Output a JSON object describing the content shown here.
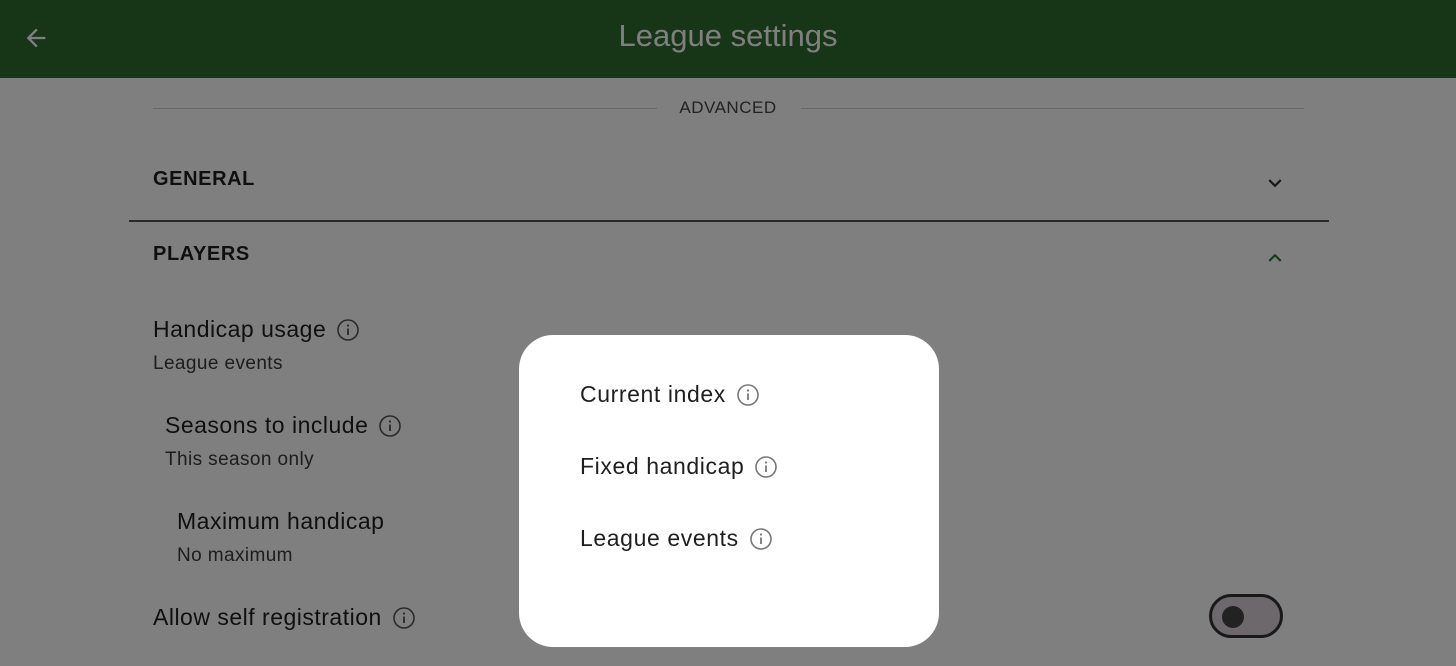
{
  "appbar": {
    "title": "League settings",
    "back_icon": "arrow-left-icon"
  },
  "divider": {
    "label": "ADVANCED"
  },
  "sections": {
    "general": {
      "label": "GENERAL",
      "state": "collapsed"
    },
    "players": {
      "label": "PLAYERS",
      "state": "expanded"
    }
  },
  "settings": {
    "handicap_usage": {
      "title": "Handicap usage",
      "value": "League events"
    },
    "seasons": {
      "title": "Seasons to include",
      "value": "This season only"
    },
    "max_handicap": {
      "title": "Maximum handicap",
      "value": "No maximum"
    },
    "self_registration": {
      "title": "Allow self registration",
      "enabled": false
    }
  },
  "dialog": {
    "options": [
      {
        "label": "Current index"
      },
      {
        "label": "Fixed handicap"
      },
      {
        "label": "League events"
      }
    ]
  },
  "colors": {
    "appbar": "#2e6b2e",
    "accent": "#2e7d32",
    "scrim": "rgba(0,0,0,0.5)"
  }
}
